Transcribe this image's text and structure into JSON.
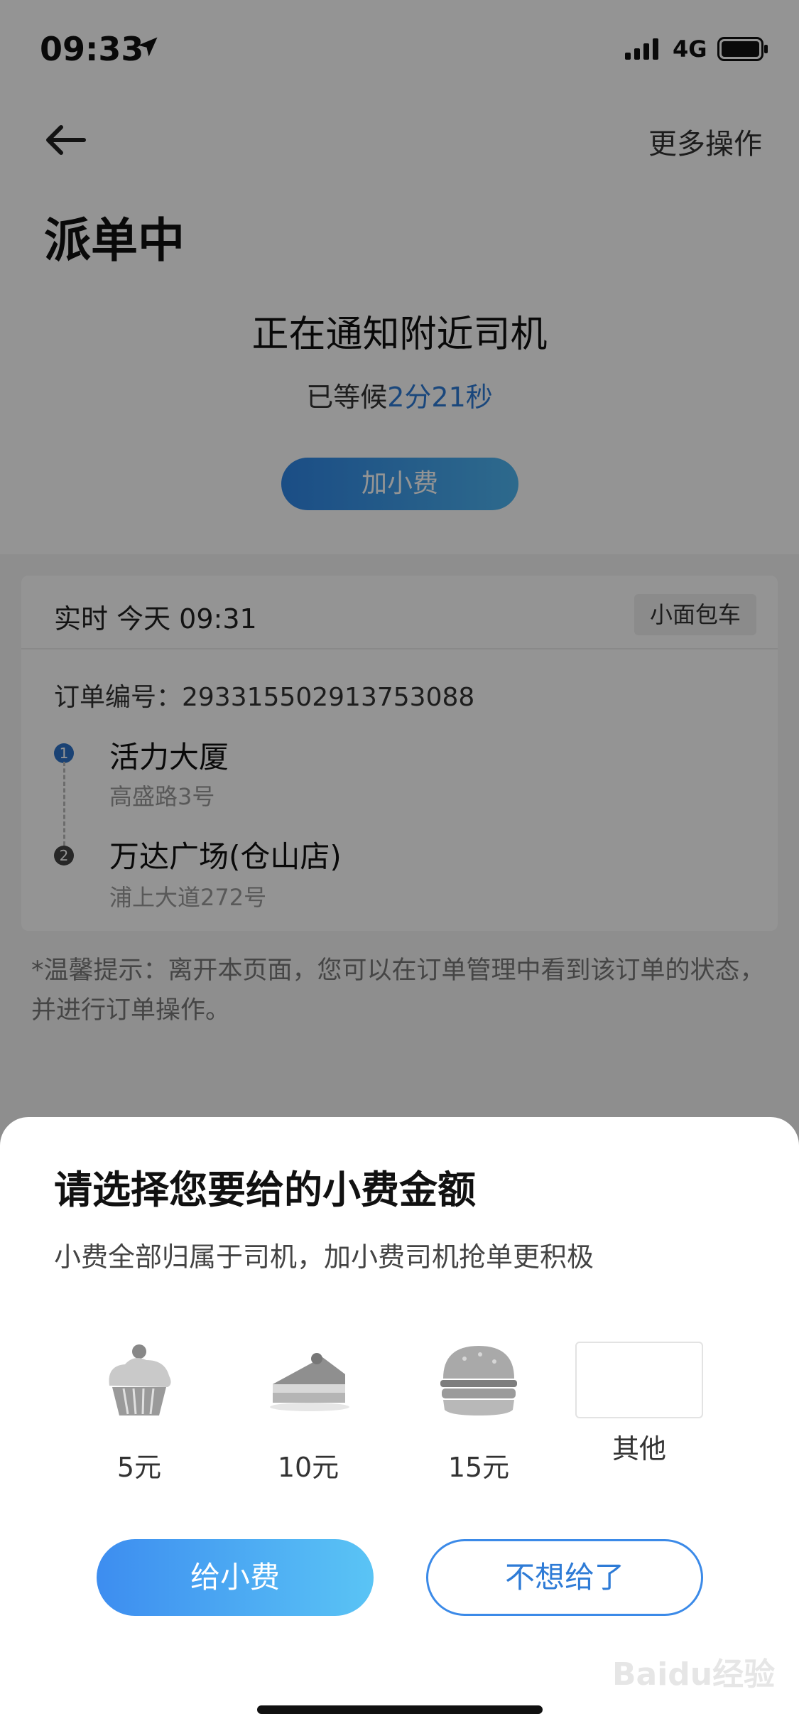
{
  "status_bar": {
    "time": "09:33",
    "network": "4G"
  },
  "header": {
    "more_label": "更多操作",
    "title": "派单中"
  },
  "dispatch": {
    "notify_text": "正在通知附近司机",
    "wait_prefix": "已等候",
    "wait_time": "2分21秒",
    "add_tip_label": "加小费"
  },
  "order": {
    "realtime": "实时  今天 09:31",
    "car_type": "小面包车",
    "order_no": "订单编号：293315502913753088",
    "stops": [
      {
        "index": "1",
        "name": "活力大厦",
        "address": "高盛路3号",
        "color": "#2e73c9"
      },
      {
        "index": "2",
        "name": "万达广场(仓山店)",
        "address": "浦上大道272号",
        "color": "#444444"
      }
    ]
  },
  "hint": "*温馨提示：离开本页面，您可以在订单管理中看到该订单的状态，并进行订单操作。",
  "tip_sheet": {
    "title": "请选择您要给的小费金额",
    "subtitle": "小费全部归属于司机，加小费司机抢单更积极",
    "options": [
      {
        "label": "5元",
        "icon": "cupcake-icon"
      },
      {
        "label": "10元",
        "icon": "cake-slice-icon"
      },
      {
        "label": "15元",
        "icon": "burger-icon"
      },
      {
        "label": "其他",
        "icon": "custom-amount-box"
      }
    ],
    "give_label": "给小费",
    "decline_label": "不想给了"
  },
  "watermark": "Baidu经验",
  "colors": {
    "accent": "#2e7bd6",
    "gradient_start": "#3d8df0",
    "gradient_end": "#5ac4f5"
  }
}
